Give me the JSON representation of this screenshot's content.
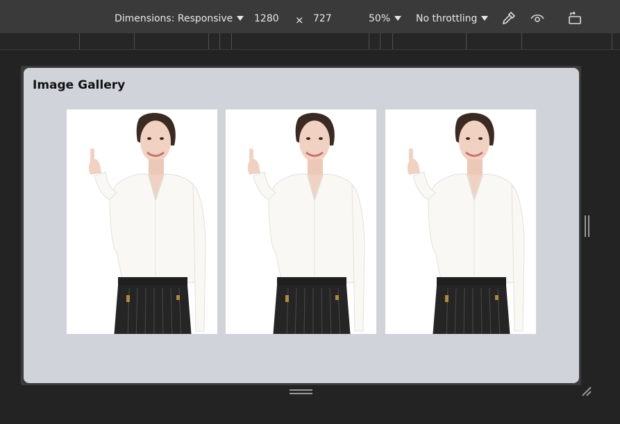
{
  "toolbar": {
    "dimensions_label": "Dimensions: Responsive",
    "width_value": "1280",
    "times_symbol": "×",
    "height_value": "727",
    "zoom_label": "50%",
    "throttle_label": "No throttling",
    "icons": [
      "eyedropper-icon",
      "eye-icon",
      "rotate-icon"
    ]
  },
  "gallery": {
    "title": "Image Gallery",
    "images": [
      {
        "subject": "woman-pointing-up"
      },
      {
        "subject": "woman-pointing-up"
      },
      {
        "subject": "woman-pointing-up"
      }
    ]
  },
  "colors": {
    "toolbar_bg": "#3a3a3a",
    "page_bg": "#232323",
    "viewport_bg": "#d1d3db",
    "text": "#e8e8e8"
  }
}
